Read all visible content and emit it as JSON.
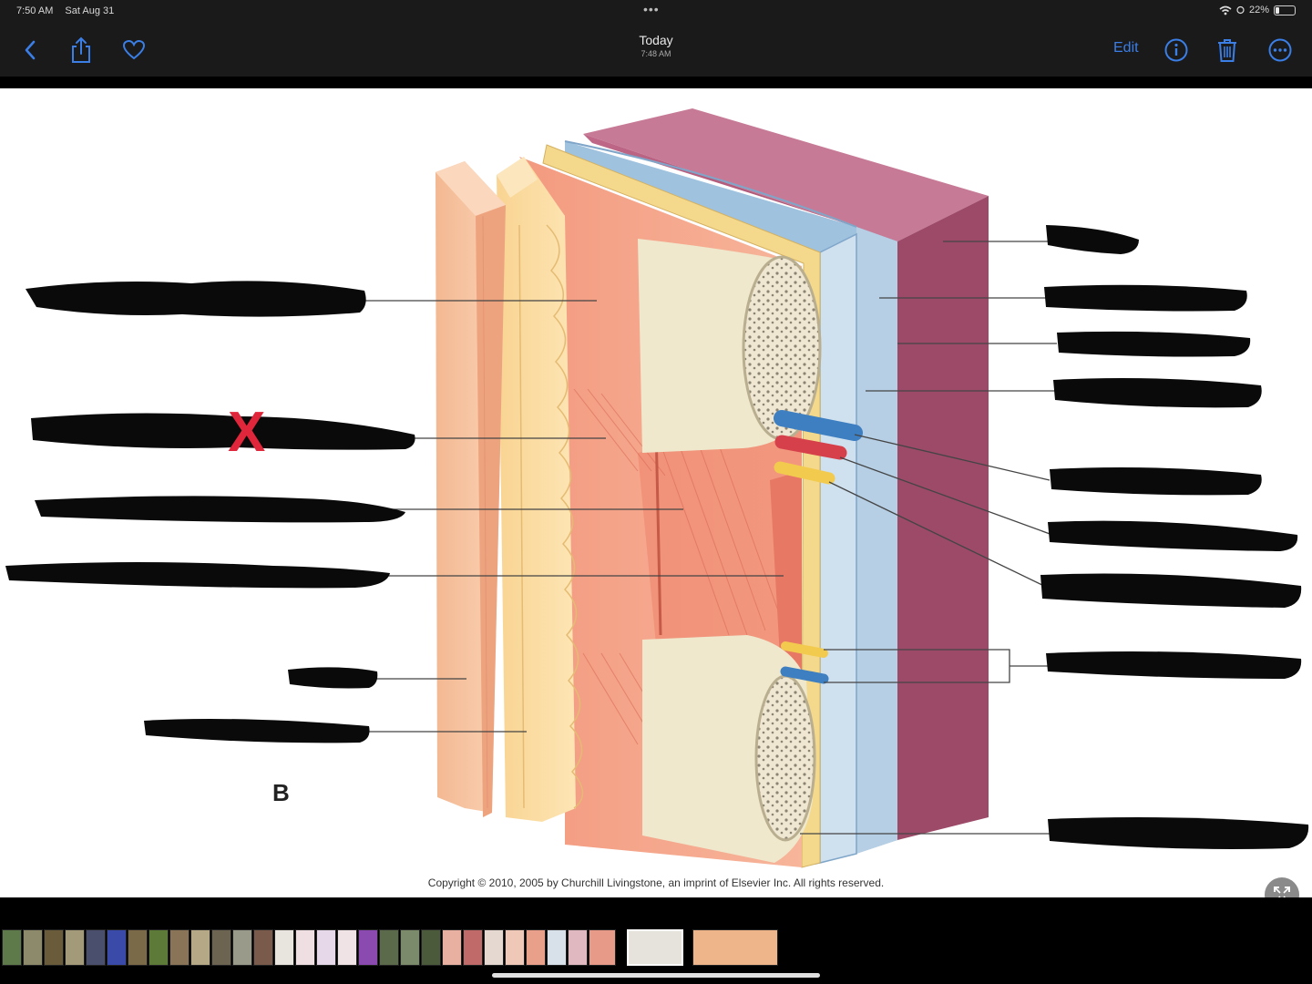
{
  "status_bar": {
    "time": "7:50 AM",
    "date": "Sat Aug 31",
    "dots": "•••",
    "battery": "22%",
    "battery_level": 0.22
  },
  "nav": {
    "title": "Today",
    "subtitle": "7:48 AM",
    "edit_label": "Edit"
  },
  "icons": {
    "back": "chevron-left-icon",
    "share": "share-icon",
    "favorite": "heart-icon",
    "info": "info-icon",
    "delete": "trash-icon",
    "more": "ellipsis-circle-icon",
    "expand": "expand-icon"
  },
  "colors": {
    "accent": "#3a7ee6",
    "bar_bg": "#1a1a1a",
    "redaction": "#0a0a0a",
    "mark": "#e0263a"
  },
  "photo": {
    "panel_letter": "B",
    "copyright": "Copyright © 2010, 2005 by Churchill Livingstone, an imprint of Elsevier Inc. All rights reserved.",
    "correction_mark": "X"
  }
}
